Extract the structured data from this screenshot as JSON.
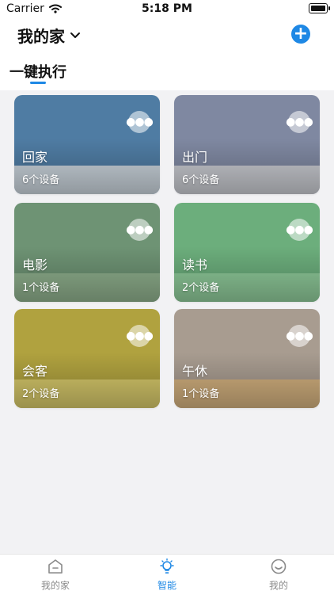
{
  "status": {
    "carrier": "Carrier",
    "time": "5:18 PM"
  },
  "header": {
    "home_title": "我的家",
    "section_title": "一键执行"
  },
  "scenes": [
    {
      "name": "回家",
      "count": "6个设备",
      "bg": "#4f7ca3"
    },
    {
      "name": "出门",
      "count": "6个设备",
      "bg": "#7f88a1"
    },
    {
      "name": "电影",
      "count": "1个设备",
      "bg": "#6e9374"
    },
    {
      "name": "读书",
      "count": "2个设备",
      "bg": "#6cae7c"
    },
    {
      "name": "会客",
      "count": "2个设备",
      "bg": "#b0a23f"
    },
    {
      "name": "午休",
      "count": "1个设备",
      "bg": "#a89c90"
    }
  ],
  "tabbar": {
    "items": [
      {
        "label": "我的家",
        "active": false
      },
      {
        "label": "智能",
        "active": true
      },
      {
        "label": "我的",
        "active": false
      }
    ]
  },
  "colors": {
    "accent": "#1e88e5",
    "inactive": "#8a8a8a"
  }
}
